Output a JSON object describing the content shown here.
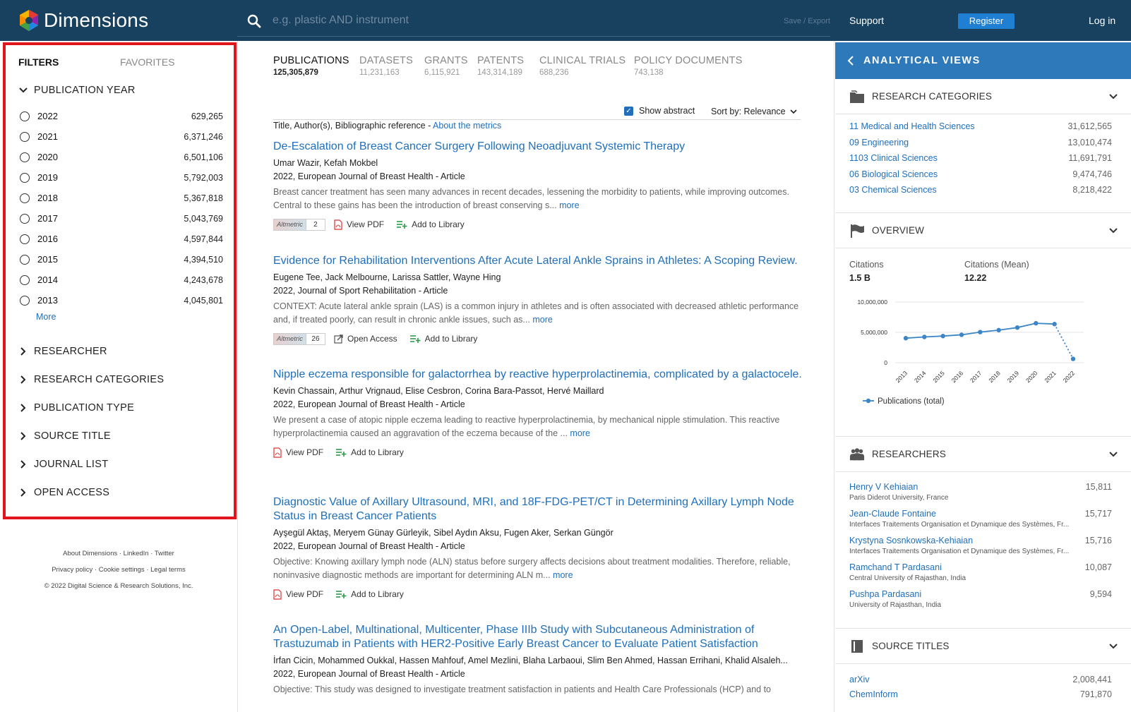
{
  "header": {
    "brand": "Dimensions",
    "search_placeholder": "e.g. plastic AND instrument",
    "save_export": "Save / Export",
    "support": "Support",
    "register": "Register",
    "login": "Log in"
  },
  "sidebar": {
    "tab_filters": "FILTERS",
    "tab_favorites": "FAVORITES",
    "publication_year_heading": "PUBLICATION YEAR",
    "years": [
      {
        "year": "2022",
        "count": "629,265"
      },
      {
        "year": "2021",
        "count": "6,371,246"
      },
      {
        "year": "2020",
        "count": "6,501,106"
      },
      {
        "year": "2019",
        "count": "5,792,003"
      },
      {
        "year": "2018",
        "count": "5,367,818"
      },
      {
        "year": "2017",
        "count": "5,043,769"
      },
      {
        "year": "2016",
        "count": "4,597,844"
      },
      {
        "year": "2015",
        "count": "4,394,510"
      },
      {
        "year": "2014",
        "count": "4,243,678"
      },
      {
        "year": "2013",
        "count": "4,045,801"
      }
    ],
    "more": "More",
    "sections": [
      "RESEARCHER",
      "RESEARCH CATEGORIES",
      "PUBLICATION TYPE",
      "SOURCE TITLE",
      "JOURNAL LIST",
      "OPEN ACCESS"
    ],
    "footer_line1": "About Dimensions · LinkedIn · Twitter",
    "footer_line2": "Privacy policy · Cookie settings · Legal terms",
    "footer_line3": "© 2022 Digital Science & Research Solutions, Inc."
  },
  "center": {
    "tabs": [
      {
        "label": "PUBLICATIONS",
        "count": "125,305,879"
      },
      {
        "label": "DATASETS",
        "count": "11,231,163"
      },
      {
        "label": "GRANTS",
        "count": "6,115,921"
      },
      {
        "label": "PATENTS",
        "count": "143,314,189"
      },
      {
        "label": "CLINICAL TRIALS",
        "count": "688,236"
      },
      {
        "label": "POLICY DOCUMENTS",
        "count": "743,138"
      }
    ],
    "show_abstract": "Show abstract",
    "sort_by": "Sort by: Relevance",
    "metrics_prefix": "Title, Author(s), Bibliographic reference - ",
    "metrics_link": "About the metrics",
    "more_label": "more",
    "altmetric_label": "Altmetric",
    "view_pdf": "View PDF",
    "open_access": "Open Access",
    "add_to_library": "Add to Library",
    "results": [
      {
        "title": "De-Escalation of Breast Cancer Surgery Following Neoadjuvant Systemic Therapy",
        "authors": "Umar Wazir, Kefah Mokbel",
        "source": "2022, European Journal of Breast Health - Article",
        "abstract": "Breast cancer treatment has seen many advances in recent decades, lessening the morbidity to patients, while improving outcomes. Central to these gains has been the introduction of breast conserving s...",
        "altmetric": "2"
      },
      {
        "title": "Evidence for Rehabilitation Interventions After Acute Lateral Ankle Sprains in Athletes: A Scoping Review.",
        "authors": "Eugene Tee, Jack Melbourne, Larissa Sattler, Wayne Hing",
        "source": "2022, Journal of Sport Rehabilitation - Article",
        "abstract": "CONTEXT: Acute lateral ankle sprain (LAS) is a common injury in athletes and is often associated with decreased athletic performance and, if treated poorly, can result in chronic ankle issues, such as...",
        "altmetric": "26"
      },
      {
        "title": "Nipple eczema responsible for galactorrhea by reactive hyperprolactinemia, complicated by a galactocele.",
        "authors": "Kevin Chassain, Arthur Vrignaud, Elise Cesbron, Corina Bara-Passot, Hervé Maillard",
        "source": "2022, European Journal of Breast Health - Article",
        "abstract": "We present a case of atopic nipple eczema leading to reactive hyperprolactinemia, by mechanical nipple stimulation. This reactive hyperprolactinemia caused an aggravation of the eczema because of the ..."
      },
      {
        "title": "Diagnostic Value of Axillary Ultrasound, MRI, and 18F-FDG-PET/CT in Determining Axillary Lymph Node Status in Breast Cancer Patients",
        "authors": "Ayşegül Aktaş, Meryem Günay Gürleyik, Sibel Aydın Aksu, Fugen Aker, Serkan Güngör",
        "source": "2022, European Journal of Breast Health - Article",
        "abstract": "Objective: Knowing axillary lymph node (ALN) status before surgery affects decisions about treatment modalities. Therefore, reliable, noninvasive diagnostic methods are important for determining ALN m..."
      },
      {
        "title": "An Open-Label, Multinational, Multicenter, Phase IIIb Study with Subcutaneous Administration of Trastuzumab in Patients with HER2-Positive Early Breast Cancer to Evaluate Patient Satisfaction",
        "authors": "İrfan Cicin, Mohammed Oukkal, Hassen Mahfouf, Amel Mezlini, Blaha Larbaoui, Slim Ben Ahmed, Hassan Errihani, Khalid Alsaleh...",
        "source": "2022, European Journal of Breast Health - Article",
        "abstract": "Objective: This study was designed to investigate treatment satisfaction in patients and Health Care Professionals (HCP) and to"
      }
    ]
  },
  "right": {
    "title": "ANALYTICAL VIEWS",
    "research_categories_heading": "RESEARCH CATEGORIES",
    "categories": [
      {
        "name": "11 Medical and Health Sciences",
        "value": "31,612,565"
      },
      {
        "name": "09 Engineering",
        "value": "13,010,474"
      },
      {
        "name": "1103 Clinical Sciences",
        "value": "11,691,791"
      },
      {
        "name": "06 Biological Sciences",
        "value": "9,474,746"
      },
      {
        "name": "03 Chemical Sciences",
        "value": "8,218,422"
      }
    ],
    "overview_heading": "OVERVIEW",
    "citations_label": "Citations",
    "citations_value": "1.5 B",
    "citations_mean_label": "Citations (Mean)",
    "citations_mean_value": "12.22",
    "researchers_heading": "RESEARCHERS",
    "researchers": [
      {
        "name": "Henry V Kehiaian",
        "affiliation": "Paris Diderot University, France",
        "value": "15,811"
      },
      {
        "name": "Jean-Claude Fontaine",
        "affiliation": "Interfaces Traitements Organisation et Dynamique des Systèmes, Fr...",
        "value": "15,717"
      },
      {
        "name": "Krystyna Sosnkowska-Kehiaian",
        "affiliation": "Interfaces Traitements Organisation et Dynamique des Systèmes, Fr...",
        "value": "15,716"
      },
      {
        "name": "Ramchand T Pardasani",
        "affiliation": "Central University of Rajasthan, India",
        "value": "10,087"
      },
      {
        "name": "Pushpa Pardasani",
        "affiliation": "University of Rajasthan, India",
        "value": "9,594"
      }
    ],
    "source_titles_heading": "SOURCE TITLES",
    "sources": [
      {
        "name": "arXiv",
        "value": "2,008,441"
      },
      {
        "name": "ChemInform",
        "value": "791,870"
      }
    ]
  },
  "colors": {
    "header_bg": "#18405f",
    "panel_accent": "#2d79b9",
    "link": "#1f6fbd",
    "highlight_border": "#e0151d",
    "chart_line": "#3d86c6"
  },
  "chart_data": {
    "type": "line",
    "x": [
      "2013",
      "2014",
      "2015",
      "2016",
      "2017",
      "2018",
      "2019",
      "2020",
      "2021",
      "2022"
    ],
    "series": [
      {
        "name": "Publications (total)",
        "values": [
          4045801,
          4243678,
          4394510,
          4597844,
          5043769,
          5367818,
          5792003,
          6501106,
          6371246,
          629265
        ]
      }
    ],
    "yticks": [
      "10,000,000",
      "5,000,000",
      "0"
    ],
    "ylim": [
      0,
      10000000
    ],
    "last_segment_dotted": true,
    "grid": "horizontal",
    "legend": "bottom-left"
  }
}
